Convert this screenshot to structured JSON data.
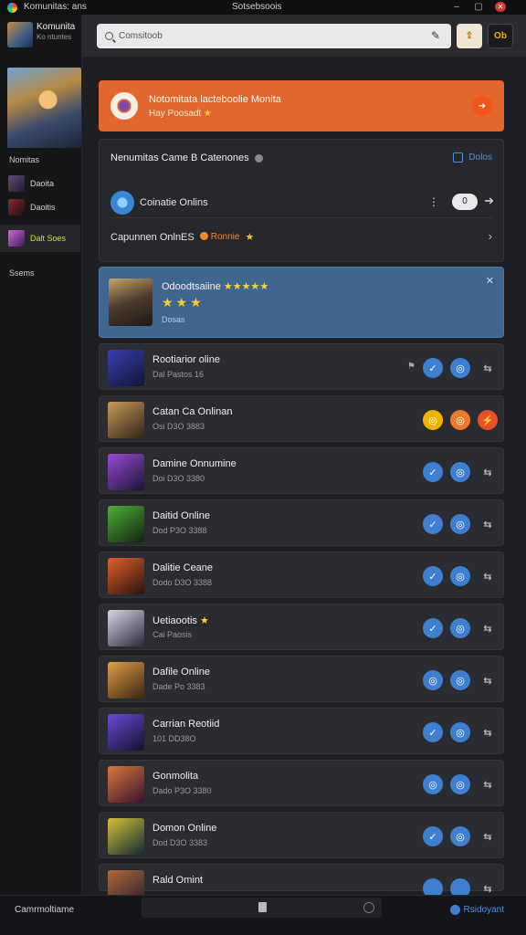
{
  "window": {
    "app_title": "Komunitas: ans",
    "center_title": "Sotsebsoois"
  },
  "sidebar": {
    "profile_name": "Komunita",
    "profile_sub": "Ko ntuntes",
    "section_label": "Nomitas",
    "items": [
      {
        "label": "Daoita",
        "thumb_color": "#6a4a7a"
      },
      {
        "label": "Daoitis",
        "thumb_color": "#8a2a2a"
      },
      {
        "label": "Dalt Soes",
        "thumb_color": "#b04ab0"
      }
    ],
    "footer_label": "Ssems"
  },
  "search": {
    "placeholder": "Comsitoob"
  },
  "topbar": {
    "gold_label": "Ob"
  },
  "banner": {
    "title": "Notomitata lacteboolie Monita",
    "subtitle": "Hay Poosadt",
    "star": "★"
  },
  "online": {
    "heading": "Nenumitas Came B Catenones",
    "more_label": "Dolos",
    "row1_label": "Coinatie Onlins",
    "row1_toggle": "0",
    "row2_label": "Capunnen OnlnES",
    "row2_badge": "Ronnie",
    "row2_star": "★"
  },
  "featured": {
    "title": "Odoodtsaiine",
    "title_stars": "★★★★★",
    "rating_stars": "★★★",
    "sub": "Dosas"
  },
  "games": [
    {
      "name": "Rootiarior oline",
      "meta": "Dal Pastos 16",
      "color_a": "#3a3fb0",
      "color_b": "#101436",
      "pre": "⚑",
      "a1": "✓",
      "a2": "◎",
      "a3": "⇆",
      "c1": "blue",
      "c2": "blue",
      "c3": ""
    },
    {
      "name": "Catan Ca Onlinan",
      "meta": "Osi D3O 3883",
      "color_a": "#c99a5a",
      "color_b": "#2e2418",
      "pre": "",
      "a1": "◎",
      "a2": "◎",
      "a3": "⚡",
      "c1": "yellow",
      "c2": "orange",
      "c3": "red"
    },
    {
      "name": "Damine Onnumine",
      "meta": "Doi D3O 3380",
      "color_a": "#9a4ad6",
      "color_b": "#1c1436",
      "pre": "",
      "a1": "✓",
      "a2": "◎",
      "a3": "⇆",
      "c1": "blue",
      "c2": "blue",
      "c3": ""
    },
    {
      "name": "Daitid Online",
      "meta": "Dod P3O 3388",
      "color_a": "#4fae3a",
      "color_b": "#10240e",
      "pre": "",
      "a1": "✓",
      "a2": "◎",
      "a3": "⇆",
      "c1": "blue",
      "c2": "blue",
      "c3": ""
    },
    {
      "name": "Dalitie Ceane",
      "meta": "Dodo D3O 3388",
      "color_a": "#e0602a",
      "color_b": "#2a1210",
      "pre": "",
      "a1": "✓",
      "a2": "◎",
      "a3": "⇆",
      "c1": "blue",
      "c2": "blue",
      "c3": ""
    },
    {
      "name": "Uetiaootis",
      "star": "★",
      "meta": "Cai Paosis",
      "color_a": "#d6d6e6",
      "color_b": "#2a2a3a",
      "pre": "",
      "a1": "✓",
      "a2": "◎",
      "a3": "⇆",
      "c1": "blue",
      "c2": "blue",
      "c3": ""
    },
    {
      "name": "Dafile Online",
      "meta": "Dade Po 3383",
      "color_a": "#e0a04a",
      "color_b": "#3a2410",
      "pre": "",
      "a1": "◎",
      "a2": "◎",
      "a3": "⇆",
      "c1": "blue",
      "c2": "blue",
      "c3": ""
    },
    {
      "name": "Carrian Reotiid",
      "meta": "101 DD38O",
      "color_a": "#6a4ad6",
      "color_b": "#14102e",
      "pre": "",
      "a1": "✓",
      "a2": "◎",
      "a3": "⇆",
      "c1": "blue",
      "c2": "blue",
      "c3": ""
    },
    {
      "name": "Gonmolita",
      "meta": "Dado P3O 3380",
      "color_a": "#d67a3a",
      "color_b": "#3a1030",
      "pre": "",
      "a1": "◎",
      "a2": "◎",
      "a3": "⇆",
      "c1": "blue",
      "c2": "blue",
      "c3": ""
    },
    {
      "name": "Domon Online",
      "meta": "Dod D3O 3383",
      "color_a": "#d6c03a",
      "color_b": "#102a30",
      "pre": "",
      "a1": "✓",
      "a2": "◎",
      "a3": "⇆",
      "c1": "blue",
      "c2": "blue",
      "c3": ""
    },
    {
      "name": "Rald Omint",
      "meta": "",
      "color_a": "#b06a3a",
      "color_b": "#241830",
      "pre": "",
      "a1": "",
      "a2": "",
      "a3": "⇆",
      "c1": "blue",
      "c2": "blue",
      "c3": ""
    }
  ],
  "bottombar": {
    "left_label": "Camrmoltiame",
    "right_label": "Rsidoyant"
  }
}
